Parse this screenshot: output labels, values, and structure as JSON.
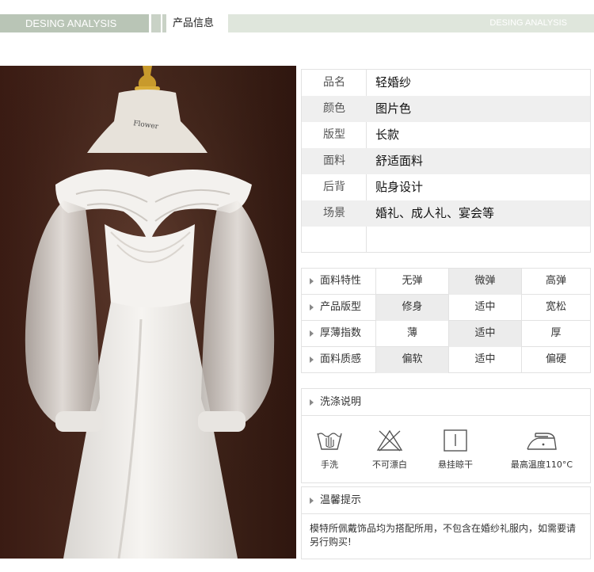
{
  "header": {
    "left_text": "DESING ANALYSIS",
    "title": "产品信息",
    "right_text": "DESING ANALYSIS"
  },
  "photo": {
    "description_icon": "wedding-dress-photo",
    "tag_text": "Flower"
  },
  "info": {
    "rows": [
      {
        "key": "品名",
        "value": "轻婚纱"
      },
      {
        "key": "颜色",
        "value": "图片色"
      },
      {
        "key": "版型",
        "value": "长款"
      },
      {
        "key": "面料",
        "value": "舒适面料"
      },
      {
        "key": "后背",
        "value": "贴身设计"
      },
      {
        "key": "场景",
        "value": "婚礼、成人礼、宴会等"
      }
    ]
  },
  "attributes": {
    "rows": [
      {
        "label": "面料特性",
        "options": [
          "无弹",
          "微弹",
          "高弹"
        ],
        "selected": 1
      },
      {
        "label": "产品版型",
        "options": [
          "修身",
          "适中",
          "宽松"
        ],
        "selected": 0
      },
      {
        "label": "厚薄指数",
        "options": [
          "薄",
          "适中",
          "厚"
        ],
        "selected": 1
      },
      {
        "label": "面料质感",
        "options": [
          "偏软",
          "适中",
          "偏硬"
        ],
        "selected": 0
      }
    ],
    "selected_color": "#ececec"
  },
  "wash": {
    "title": "洗涤说明",
    "items": [
      {
        "icon": "hand-wash-icon",
        "label": "手洗"
      },
      {
        "icon": "no-bleach-icon",
        "label": "不可漂白"
      },
      {
        "icon": "hang-dry-icon",
        "label": "悬挂晾干"
      },
      {
        "icon": "iron-110-icon",
        "label": "最高温度110°C"
      }
    ]
  },
  "notice": {
    "title": "温馨提示",
    "text": "模特所佩戴饰品均为搭配所用，不包含在婚纱礼服内，如需要请另行购买!"
  },
  "colors": {
    "header_green": "#b9c5b6",
    "header_light": "#dfe6dc",
    "row_alt": "#efefef"
  }
}
